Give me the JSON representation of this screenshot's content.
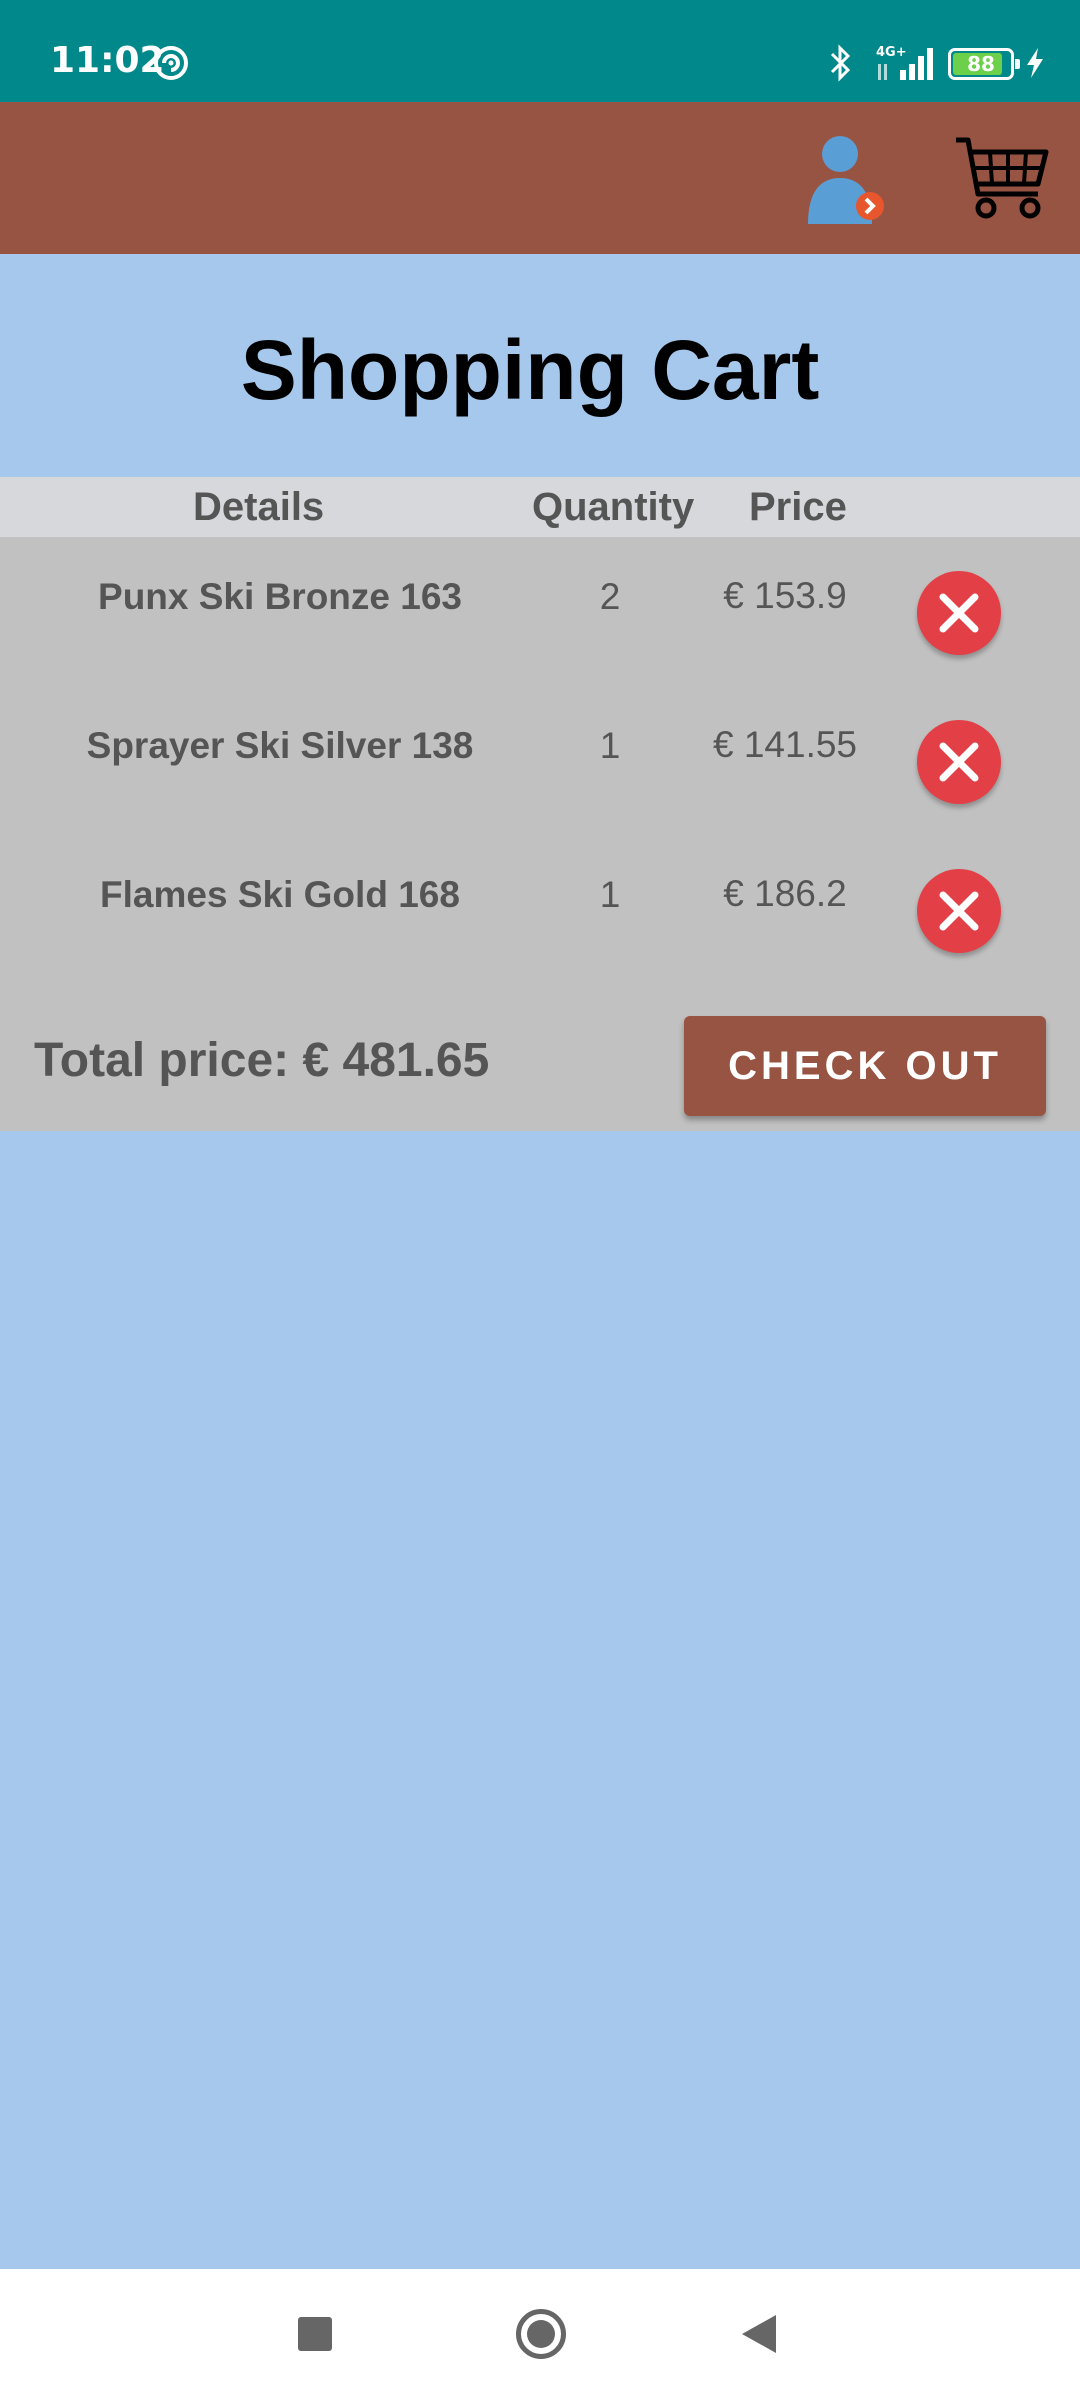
{
  "status_bar": {
    "time": "11:02",
    "network": "4G+",
    "battery_level": "88",
    "battery_percent": 88,
    "icons": [
      "sync-icon",
      "bluetooth-icon",
      "signal-icon",
      "battery-icon",
      "charging-icon"
    ]
  },
  "app_bar": {
    "account_icon": "account-icon",
    "cart_icon": "shopping-cart-icon",
    "color": "#985442"
  },
  "page": {
    "title": "Shopping Cart"
  },
  "table": {
    "headers": {
      "details": "Details",
      "quantity": "Quantity",
      "price": "Price"
    },
    "rows": [
      {
        "name": "Punx Ski Bronze 163",
        "quantity": "2",
        "price": "€ 153.9"
      },
      {
        "name": "Sprayer Ski Silver 138",
        "quantity": "1",
        "price": "€ 141.55"
      },
      {
        "name": "Flames Ski Gold 168",
        "quantity": "1",
        "price": "€ 186.2"
      }
    ]
  },
  "summary": {
    "total_label": "Total price: € 481.65",
    "checkout_label": "CHECK OUT"
  },
  "colors": {
    "status_bar": "#00888a",
    "app_bar": "#985442",
    "background": "#a5c8ec",
    "table": "#c1c1c1",
    "remove": "#e23f46"
  }
}
